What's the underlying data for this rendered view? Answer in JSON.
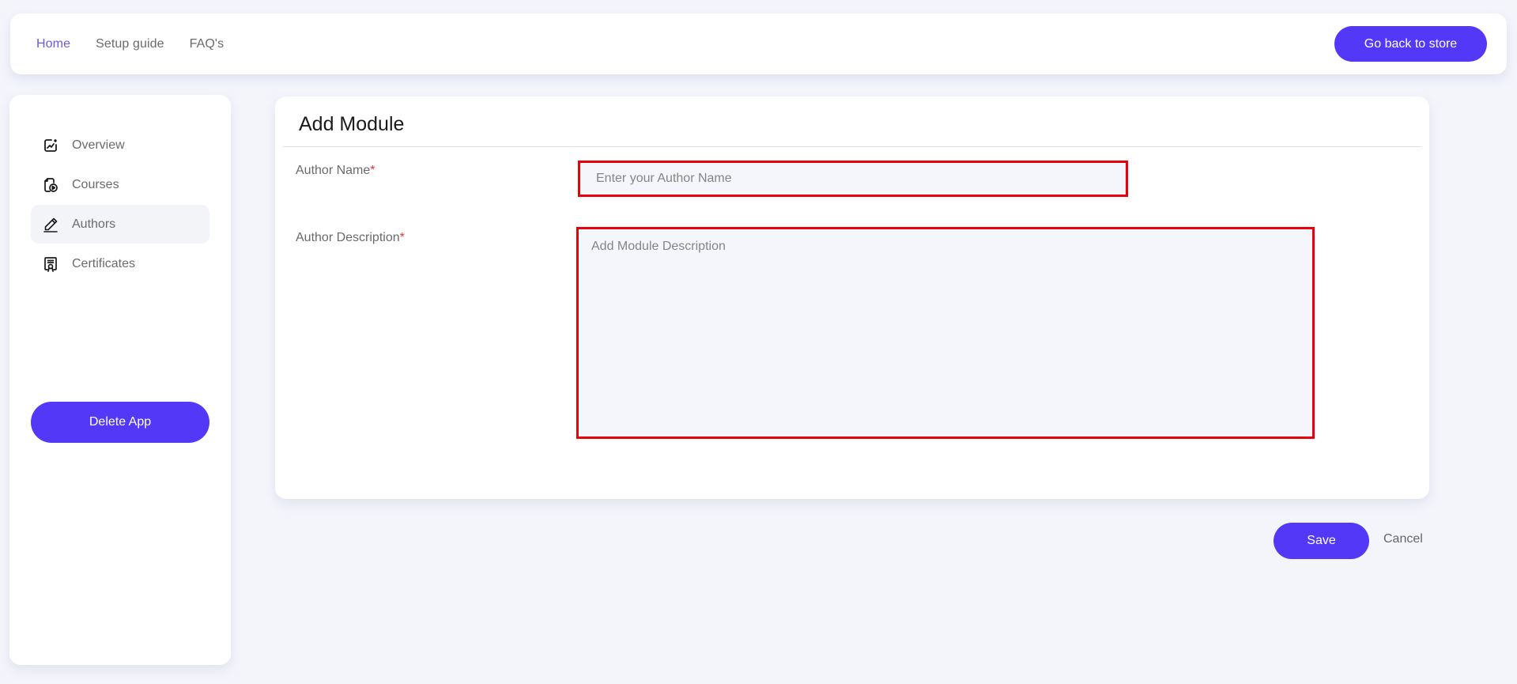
{
  "topnav": {
    "links": [
      {
        "label": "Home",
        "active": true
      },
      {
        "label": "Setup guide",
        "active": false
      },
      {
        "label": "FAQ's",
        "active": false
      }
    ],
    "store_button": "Go back to store"
  },
  "sidebar": {
    "items": [
      {
        "label": "Overview",
        "icon": "chart-edit-icon",
        "active": false
      },
      {
        "label": "Courses",
        "icon": "course-video-icon",
        "active": false
      },
      {
        "label": "Authors",
        "icon": "pencil-icon",
        "active": true
      },
      {
        "label": "Certificates",
        "icon": "certificate-icon",
        "active": false
      }
    ],
    "delete_button": "Delete App"
  },
  "form": {
    "title": "Add Module",
    "author_name": {
      "label": "Author Name",
      "required_mark": "*",
      "placeholder": "Enter your Author Name",
      "value": ""
    },
    "author_description": {
      "label": "Author Description",
      "required_mark": "*",
      "placeholder": "Add Module Description",
      "value": ""
    }
  },
  "actions": {
    "save": "Save",
    "cancel": "Cancel"
  },
  "colors": {
    "accent": "#5338f8",
    "active_link": "#6a5ae0",
    "highlight_border": "#e8000b",
    "background": "#f4f5fb"
  }
}
